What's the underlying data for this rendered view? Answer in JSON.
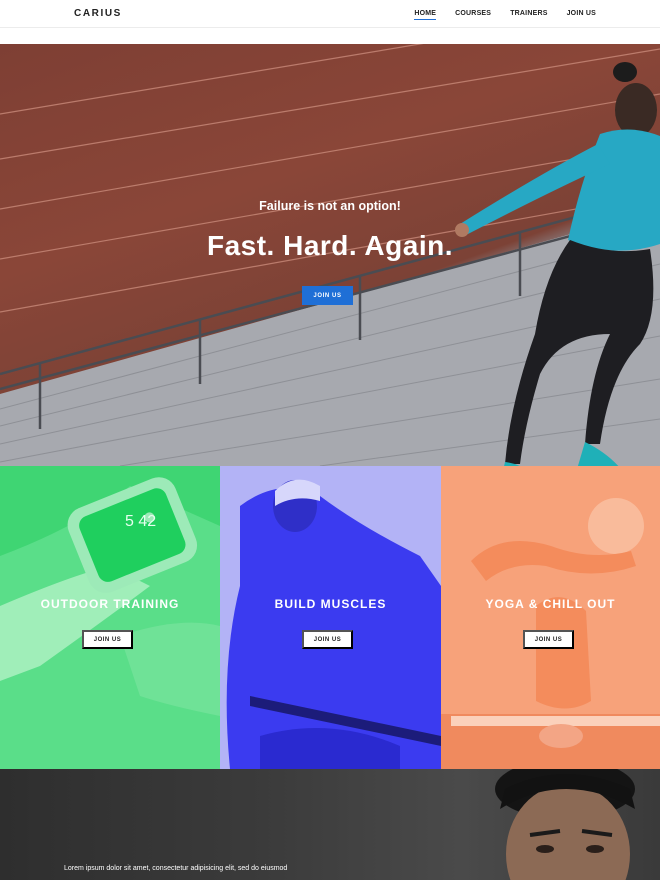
{
  "header": {
    "logo": "CARIUS",
    "nav": [
      {
        "label": "HOME",
        "active": true
      },
      {
        "label": "COURSES",
        "active": false
      },
      {
        "label": "TRAINERS",
        "active": false
      },
      {
        "label": "JOIN US",
        "active": false
      }
    ]
  },
  "hero": {
    "subtitle": "Failure is not an option!",
    "title": "Fast. Hard. Again.",
    "button_label": "JOIN US"
  },
  "features": [
    {
      "title": "OUTDOOR TRAINING",
      "button_label": "JOIN US",
      "color": "#3fd573"
    },
    {
      "title": "BUILD MUSCLES",
      "button_label": "JOIN US",
      "color": "#3f3ff0"
    },
    {
      "title": "YOGA & CHILL OUT",
      "button_label": "JOIN US",
      "color": "#f59a70"
    }
  ],
  "bottom": {
    "text": "Lorem ipsum dolor sit amet, consectetur adipisicing elit, sed do eiusmod"
  },
  "colors": {
    "accent": "#1f6fd6"
  }
}
